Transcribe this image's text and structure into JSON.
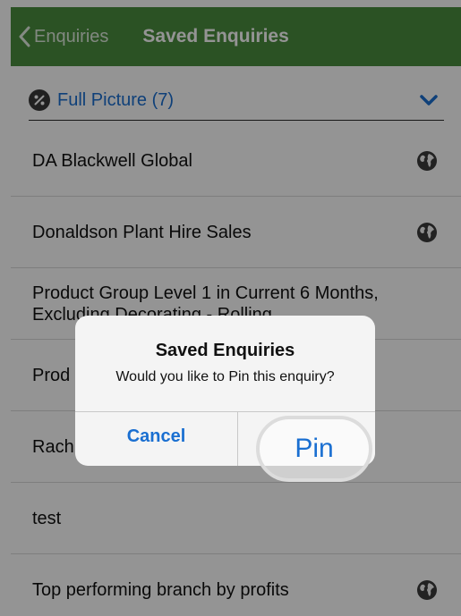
{
  "header": {
    "back_label": "Enquiries",
    "title": "Saved Enquiries"
  },
  "filter": {
    "label": "Full Picture (7)",
    "icon": "percent-badge-icon",
    "expand_icon": "chevron-down-icon"
  },
  "list": {
    "items": [
      {
        "label": "DA Blackwell Global",
        "globe": true
      },
      {
        "label": "Donaldson Plant Hire Sales",
        "globe": true
      },
      {
        "label": "Product Group Level 1 in Current 6 Months, Excluding Decorating - Rolling",
        "globe": false
      },
      {
        "label": "Prod",
        "globe": false
      },
      {
        "label": "Rach",
        "globe": false
      },
      {
        "label": "test",
        "globe": false
      },
      {
        "label": "Top performing branch by profits",
        "globe": true
      }
    ]
  },
  "dialog": {
    "title": "Saved Enquiries",
    "message": "Would you like to Pin this enquiry?",
    "cancel_label": "Cancel",
    "pin_label": "Pin"
  },
  "colors": {
    "header_bg": "#4a8e3f",
    "accent": "#1a6fd1"
  }
}
